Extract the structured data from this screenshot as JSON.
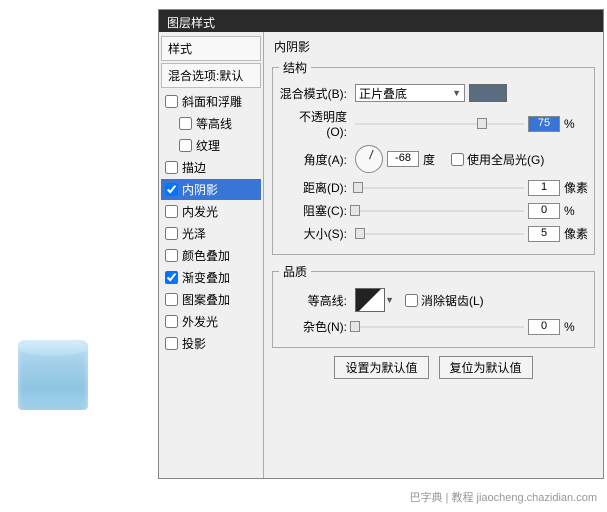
{
  "window": {
    "title": "图层样式"
  },
  "sidebar": {
    "style_header": "样式",
    "blend_header": "混合选项:默认",
    "items": [
      {
        "label": "斜面和浮雕",
        "checked": false
      },
      {
        "label": "等高线",
        "checked": false,
        "sub": true
      },
      {
        "label": "纹理",
        "checked": false,
        "sub": true
      },
      {
        "label": "描边",
        "checked": false
      },
      {
        "label": "内阴影",
        "checked": true,
        "selected": true
      },
      {
        "label": "内发光",
        "checked": false
      },
      {
        "label": "光泽",
        "checked": false
      },
      {
        "label": "颜色叠加",
        "checked": false
      },
      {
        "label": "渐变叠加",
        "checked": true
      },
      {
        "label": "图案叠加",
        "checked": false
      },
      {
        "label": "外发光",
        "checked": false
      },
      {
        "label": "投影",
        "checked": false
      }
    ]
  },
  "panel": {
    "title": "内阴影",
    "structure": {
      "legend": "结构",
      "blend_label": "混合模式(B):",
      "blend_value": "正片叠底",
      "opacity_label": "不透明度(O):",
      "opacity_value": "75",
      "opacity_unit": "%",
      "angle_label": "角度(A):",
      "angle_value": "-68",
      "angle_unit": "度",
      "global_label": "使用全局光(G)",
      "global_checked": false,
      "distance_label": "距离(D):",
      "distance_value": "1",
      "distance_unit": "像素",
      "choke_label": "阻塞(C):",
      "choke_value": "0",
      "choke_unit": "%",
      "size_label": "大小(S):",
      "size_value": "5",
      "size_unit": "像素"
    },
    "quality": {
      "legend": "品质",
      "contour_label": "等高线:",
      "antialias_label": "消除锯齿(L)",
      "antialias_checked": false,
      "noise_label": "杂色(N):",
      "noise_value": "0",
      "noise_unit": "%"
    },
    "buttons": {
      "default": "设置为默认值",
      "reset": "复位为默认值"
    }
  },
  "watermark": "巴字典 | 教程 jiaocheng.chazidian.com"
}
